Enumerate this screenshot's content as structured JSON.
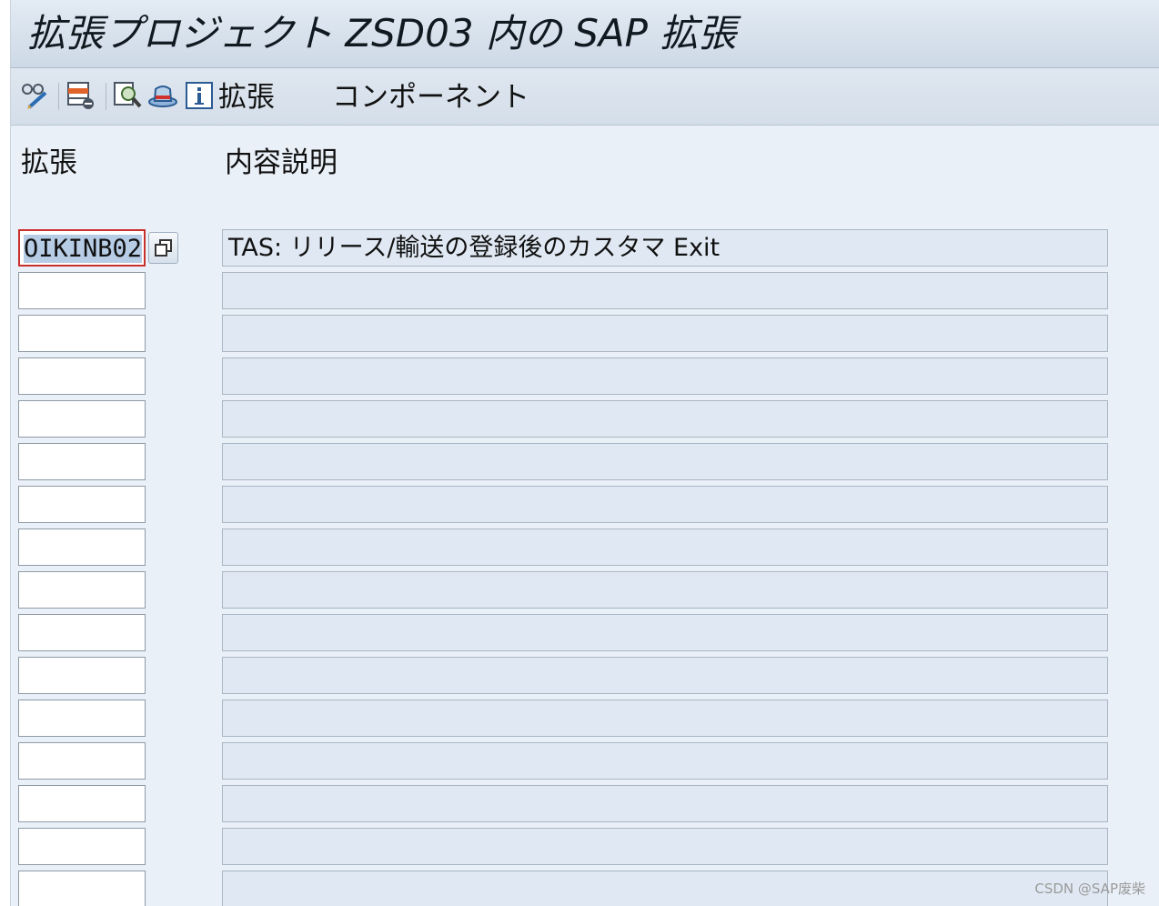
{
  "title": "拡張プロジェクト ZSD03 内の SAP 拡張",
  "toolbar": {
    "icons": [
      "display-change-icon",
      "delete-row-icon",
      "find-icon",
      "hat-icon",
      "info-icon"
    ],
    "enhancement_label": "拡張",
    "components_label": "コンポーネント"
  },
  "table": {
    "headers": {
      "enhancement": "拡張",
      "description": "内容説明"
    },
    "rows": [
      {
        "enhancement": "OIKINB02",
        "description": "TAS: リリース/輸送の登録後のカスタマ Exit"
      },
      {
        "enhancement": "",
        "description": ""
      },
      {
        "enhancement": "",
        "description": ""
      },
      {
        "enhancement": "",
        "description": ""
      },
      {
        "enhancement": "",
        "description": ""
      },
      {
        "enhancement": "",
        "description": ""
      },
      {
        "enhancement": "",
        "description": ""
      },
      {
        "enhancement": "",
        "description": ""
      },
      {
        "enhancement": "",
        "description": ""
      },
      {
        "enhancement": "",
        "description": ""
      },
      {
        "enhancement": "",
        "description": ""
      },
      {
        "enhancement": "",
        "description": ""
      },
      {
        "enhancement": "",
        "description": ""
      },
      {
        "enhancement": "",
        "description": ""
      },
      {
        "enhancement": "",
        "description": ""
      },
      {
        "enhancement": "",
        "description": ""
      }
    ]
  },
  "watermark": "CSDN @SAP废柴",
  "colors": {
    "selection_border": "#c9302c",
    "selection_highlight": "#b7cde6",
    "background": "#eaf0f8"
  }
}
